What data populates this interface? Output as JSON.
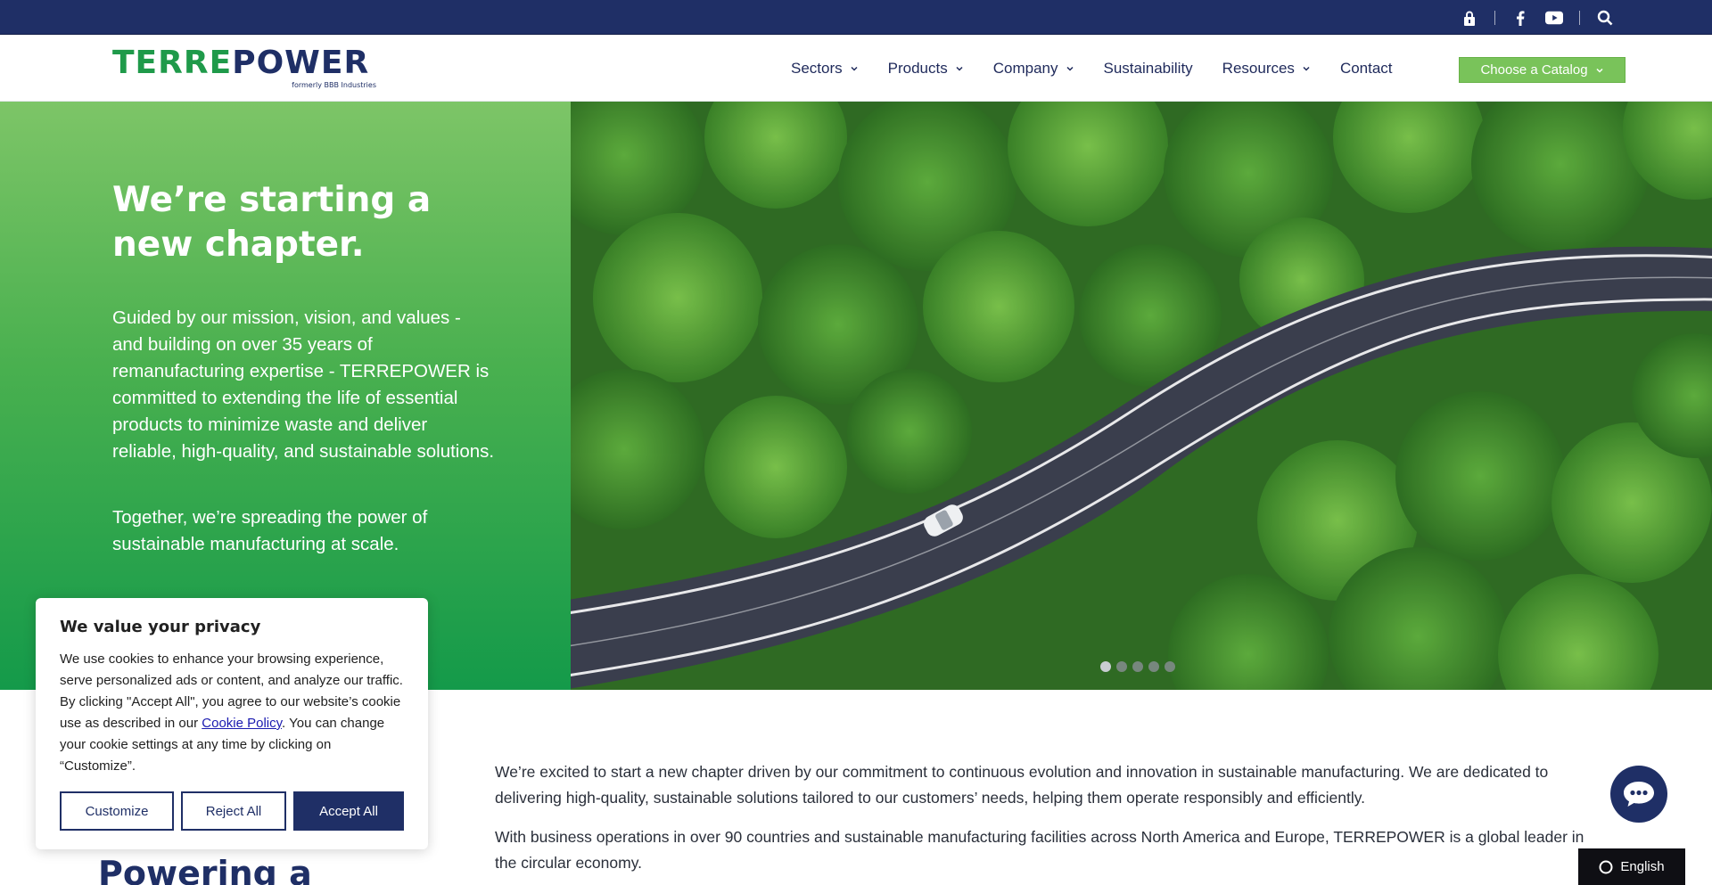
{
  "topbar": {
    "icons": [
      "lock-icon",
      "facebook-icon",
      "youtube-icon",
      "search-icon"
    ]
  },
  "header": {
    "logo": {
      "text_left": "TERRE",
      "text_right": "POWER",
      "subtitle": "formerly BBB Industries"
    },
    "nav": [
      {
        "label": "Sectors",
        "dropdown": true
      },
      {
        "label": "Products",
        "dropdown": true
      },
      {
        "label": "Company",
        "dropdown": true
      },
      {
        "label": "Sustainability",
        "dropdown": false
      },
      {
        "label": "Resources",
        "dropdown": true
      },
      {
        "label": "Contact",
        "dropdown": false
      }
    ],
    "catalog_button": "Choose a Catalog"
  },
  "hero": {
    "title": "We’re starting a new chapter.",
    "paragraph1": "Guided by our mission, vision, and values - and building on over 35 years of remanufacturing expertise - TERREPOWER is committed to extending the life of essential products to minimize waste and deliver reliable, high-quality, and sustainable solutions.",
    "paragraph2": "Together, we’re spreading the power of sustainable manufacturing at scale.",
    "slider": {
      "count": 5,
      "active": 1
    }
  },
  "intro": {
    "p1": "We’re excited to start a new chapter driven by our commitment to continuous evolution and innovation in sustainable manufacturing. We are dedicated to delivering high-quality, sustainable solutions tailored to our customers’ needs, helping them operate responsibly and efficiently.",
    "p2": "With business operations in over 90 countries and sustainable manufacturing facilities across North America and Europe, TERREPOWER is a global leader in the circular economy."
  },
  "section_heading": "Powering a",
  "cookie": {
    "title": "We value your privacy",
    "text_before_link": "We use cookies to enhance your browsing experience, serve personalized ads or content, and analyze our traffic. By clicking \"Accept All\", you agree to our website’s cookie use as described in our ",
    "link": "Cookie Policy",
    "text_after_link": ". You can change your cookie settings at any time by clicking on “Customize”.",
    "buttons": {
      "customize": "Customize",
      "reject": "Reject All",
      "accept": "Accept All"
    }
  },
  "language": {
    "label": "English"
  },
  "colors": {
    "navy": "#1f2f66",
    "green": "#1f9a4a",
    "catalog_green": "#79c35a"
  }
}
